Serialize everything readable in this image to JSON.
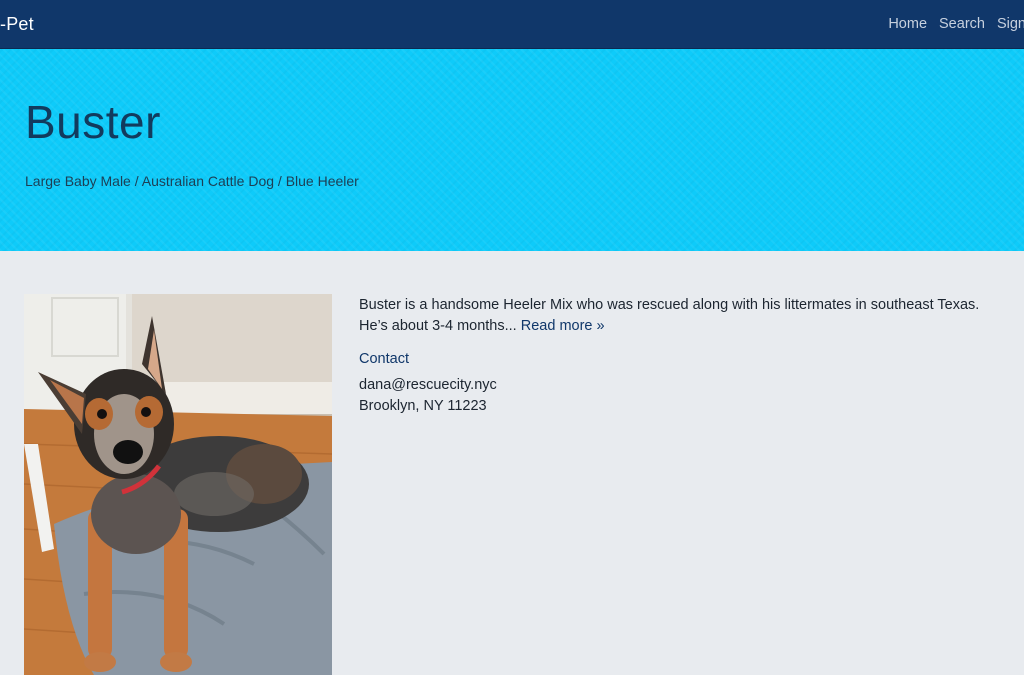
{
  "nav": {
    "brand": "-Pet",
    "links": [
      "Home",
      "Search",
      "Sign"
    ]
  },
  "hero": {
    "name": "Buster",
    "details": "Large Baby Male / Australian Cattle Dog / Blue Heeler"
  },
  "description": {
    "text": "Buster is a handsome Heeler Mix who was rescued along with his littermates in southeast Texas. He’s about 3-4 months...",
    "read_more": "Read more »"
  },
  "contact": {
    "heading": "Contact",
    "email": "dana@rescuecity.nyc",
    "location": "Brooklyn, NY 11223"
  },
  "colors": {
    "navbar": "#10376a",
    "hero": "#0ecbfa",
    "page_bg": "#e8ebef",
    "link": "#10376a"
  }
}
